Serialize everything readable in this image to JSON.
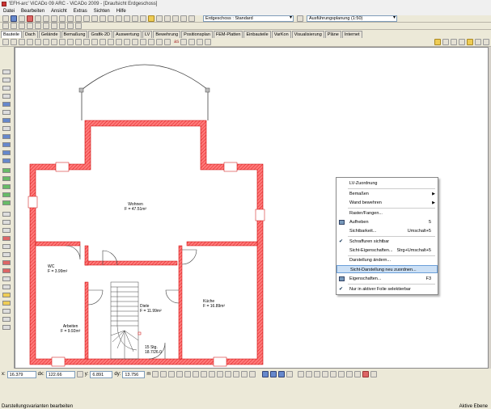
{
  "window": {
    "title": "'EFH-arc' ViCADo 09 ARC - ViCADo 2009 - [Draufsicht Erdgeschoss]"
  },
  "menu": [
    "Datei",
    "Bearbeiten",
    "Ansicht",
    "Extras",
    "Sichten",
    "Hilfe"
  ],
  "toolbar": {
    "floor_select": "Erdgeschoss : Standard",
    "plan_select": "Ausführungsplanung (1:50)",
    "text_style": "as"
  },
  "tabs": [
    "Bauteile",
    "Dach",
    "Gelände",
    "Bemaßung",
    "Grafik-2D",
    "Auswertung",
    "LV",
    "Bewehrung",
    "Positionsplan",
    "FEM-Platten",
    "Einbauteile",
    "VarKon",
    "Visualisierung",
    "Pläne",
    "Internet"
  ],
  "rooms": [
    {
      "name": "Wohnen",
      "area": "F = 47.51m²"
    },
    {
      "name": "WC",
      "area": "F = 3.99m²"
    },
    {
      "name": "Diele",
      "area": "F = 11.99m²"
    },
    {
      "name": "Küche",
      "area": "F = 16.89m²"
    },
    {
      "name": "Arbeiten",
      "area": "F = 9.92m²"
    }
  ],
  "stairs": {
    "steps": "15 Stg.",
    "dims": "18.7/26.0"
  },
  "context_menu": {
    "items": [
      {
        "label": "LV-Zuordnung"
      },
      {
        "label": "Bemaßen",
        "submenu": true
      },
      {
        "label": "Wand bewehren",
        "submenu": true
      },
      {
        "label": "Raster/Fangen..."
      },
      {
        "label": "Aufheben",
        "shortcut": "5",
        "icon": "eraser-icon"
      },
      {
        "label": "Sichtbarkeit...",
        "shortcut": "Umschalt+5"
      },
      {
        "label": "Schraffuren sichtbar",
        "checked": true
      },
      {
        "label": "Sicht-Eigenschaften...",
        "shortcut": "Strg+Umschalt+5"
      },
      {
        "label": "Darstellung ändern..."
      },
      {
        "label": "Sicht-Darstellung neu zuordnen...",
        "highlighted": true
      },
      {
        "label": "Eigenschaften...",
        "shortcut": "F3",
        "icon": "properties-icon"
      },
      {
        "label": "Nur in aktiver Folie selektierbar",
        "checked": true
      }
    ]
  },
  "coords": {
    "x_label": "x:",
    "x": "16.379",
    "dx_label": "dx:",
    "dx": "122.66",
    "y_label": "y:",
    "y": "6.891",
    "dy_label": "dy:",
    "dy": "13.756",
    "angle_label": "m"
  },
  "status": {
    "message": "Darstellungsvarianten bearbeiten",
    "right": "Aktive Ebene"
  }
}
